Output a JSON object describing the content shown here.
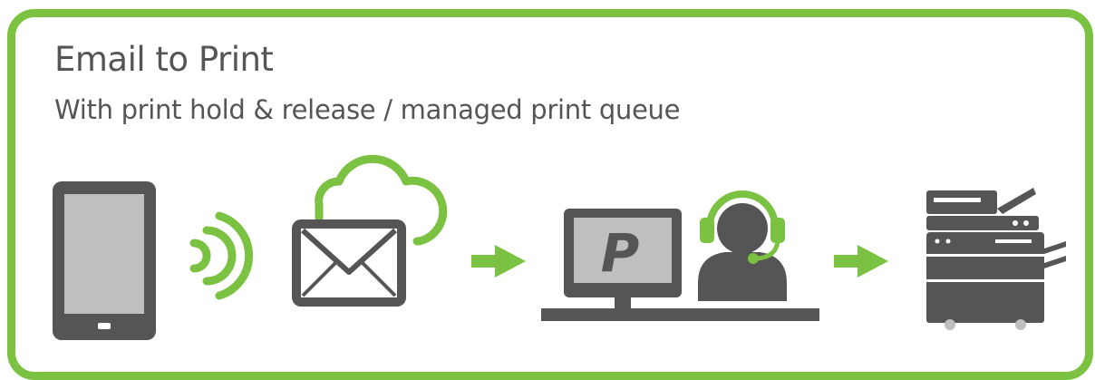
{
  "title": "Email to Print",
  "subtitle": "With print hold & release / managed print queue",
  "monitor_letter": "P",
  "colors": {
    "accent": "#7cc242",
    "icon_dark": "#555555",
    "screen_gray": "#bfbfbf",
    "text": "#555555"
  },
  "icons": [
    "tablet-icon",
    "wireless-signal-icon",
    "cloud-icon",
    "envelope-icon",
    "arrow-right-icon",
    "computer-monitor-icon",
    "headset-operator-icon",
    "arrow-right-icon",
    "printer-copier-icon"
  ]
}
